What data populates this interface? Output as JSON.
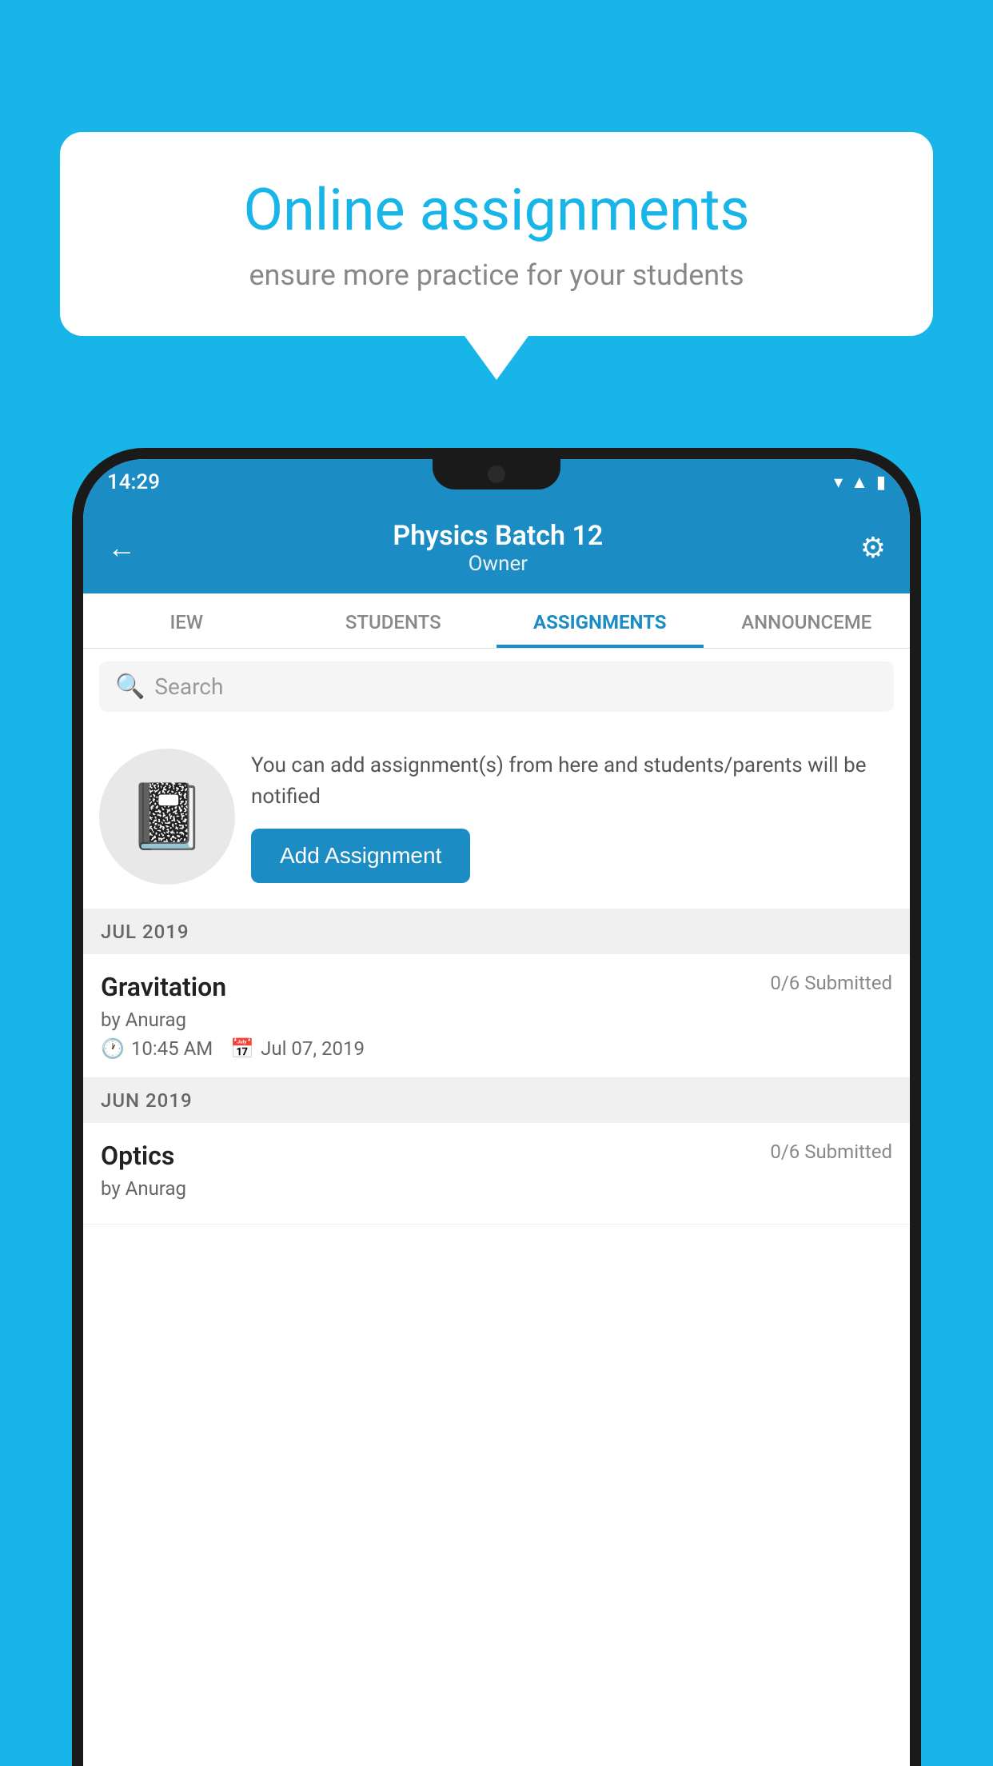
{
  "background_color": "#17B5E8",
  "speech_bubble": {
    "title": "Online assignments",
    "subtitle": "ensure more practice for your students"
  },
  "phone": {
    "status_bar": {
      "time": "14:29"
    },
    "header": {
      "title": "Physics Batch 12",
      "subtitle": "Owner",
      "back_label": "←",
      "settings_label": "⚙"
    },
    "tabs": [
      {
        "label": "IEW",
        "active": false
      },
      {
        "label": "STUDENTS",
        "active": false
      },
      {
        "label": "ASSIGNMENTS",
        "active": true
      },
      {
        "label": "ANNOUNCEME",
        "active": false
      }
    ],
    "search": {
      "placeholder": "Search"
    },
    "add_assignment": {
      "description": "You can add assignment(s) from here and students/parents will be notified",
      "button_label": "Add Assignment"
    },
    "sections": [
      {
        "month_label": "JUL 2019",
        "assignments": [
          {
            "name": "Gravitation",
            "submitted": "0/6 Submitted",
            "by": "by Anurag",
            "time": "10:45 AM",
            "date": "Jul 07, 2019"
          }
        ]
      },
      {
        "month_label": "JUN 2019",
        "assignments": [
          {
            "name": "Optics",
            "submitted": "0/6 Submitted",
            "by": "by Anurag",
            "time": "",
            "date": ""
          }
        ]
      }
    ]
  }
}
